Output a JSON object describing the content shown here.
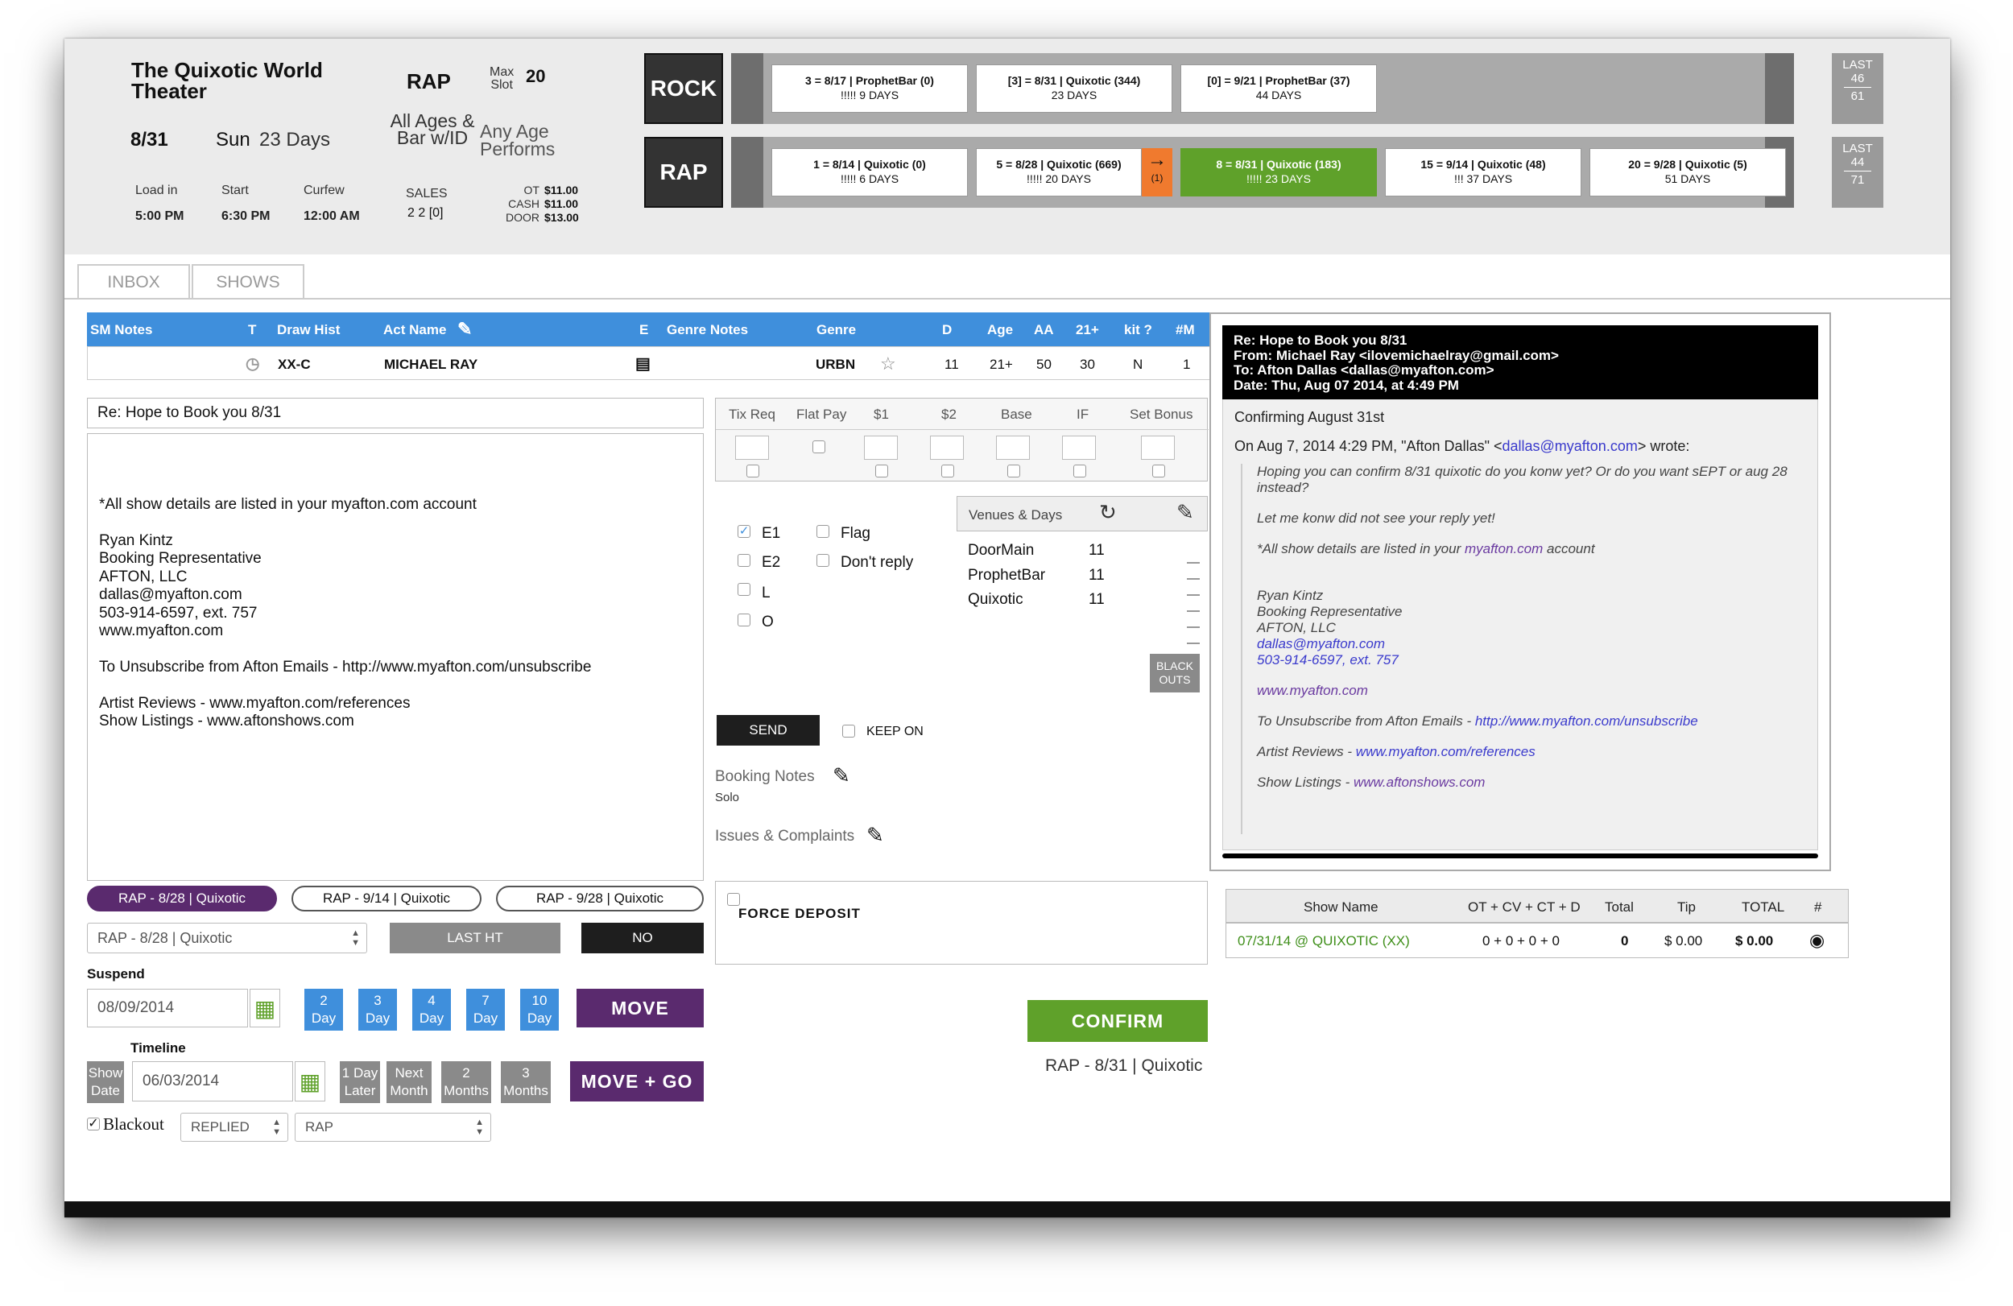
{
  "header": {
    "venue_name": "The Quixotic World Theater",
    "genre": "RAP",
    "max_slot_label1": "Max",
    "max_slot_label2": "Slot",
    "max_slot_value": "20",
    "date": "8/31",
    "day": "Sun",
    "days_away": "23 Days",
    "ages": "All Ages & Bar w/ID",
    "age_perf": "Any Age Performs",
    "load_in_label": "Load in",
    "load_in": "5:00 PM",
    "start_label": "Start",
    "start": "6:30 PM",
    "curfew_label": "Curfew",
    "curfew": "12:00 AM",
    "sales_label": "SALES",
    "sales": "2  2 [0]",
    "ot_label": "OT",
    "ot": "$11.00",
    "cash_label": "CASH",
    "cash": "$11.00",
    "door_label": "DOOR",
    "door": "$13.00"
  },
  "tracks": {
    "rock": {
      "label": "ROCK",
      "cards": [
        {
          "line1": "3  =  8/17  |  ProphetBar (0)",
          "line2": "!!!!!   9 DAYS"
        },
        {
          "line1": "[3]  =  8/31  |  Quixotic (344)",
          "line2": "23 DAYS"
        },
        {
          "line1": "[0]  =  9/21  |  ProphetBar (37)",
          "line2": "44 DAYS"
        }
      ],
      "last_label": "LAST",
      "last_a": "46",
      "last_b": "61"
    },
    "rap": {
      "label": "RAP",
      "cards": [
        {
          "line1": "1  =  8/14  |  Quixotic (0)",
          "line2": "!!!!!   6 DAYS"
        },
        {
          "line1": "5  =  8/28  |  Quixotic (669)",
          "line2": "!!!!!   20 DAYS"
        },
        {
          "line1": "8  =  8/31  |  Quixotic (183)",
          "line2": "!!!!!   23 DAYS"
        },
        {
          "line1": "15  =  9/14  |  Quixotic (48)",
          "line2": "!!!   37 DAYS"
        },
        {
          "line1": "20  =  9/28  |  Quixotic (5)",
          "line2": "51 DAYS"
        }
      ],
      "arrow_count": "(1)",
      "last_label": "LAST",
      "last_a": "44",
      "last_b": "71"
    }
  },
  "tabs": [
    "INBOX",
    "SHOWS"
  ],
  "grid": {
    "headers": [
      "SM Notes",
      "T",
      "Draw Hist",
      "Act Name",
      "E",
      "Genre Notes",
      "Genre",
      "D",
      "Age",
      "AA",
      "21+",
      "kit ?",
      "#M"
    ],
    "row": {
      "draw_hist": "XX-C",
      "act_name": "MICHAEL RAY",
      "genre": "URBN",
      "d": "11",
      "age": "21+",
      "aa": "50",
      "plus21": "30",
      "kit": "N",
      "m": "1"
    }
  },
  "compose": {
    "subject": "Re: Hope to Book you 8/31",
    "body": "\n\n\n*All show details are listed in your myafton.com account\n\nRyan Kintz\nBooking Representative\nAFTON, LLC\ndallas@myafton.com\n503-914-6597, ext. 757\nwww.myafton.com\n\nTo Unsubscribe from Afton Emails - http://www.myafton.com/unsubscribe\n\nArtist Reviews - www.myafton.com/references\nShow Listings - www.aftonshows.com"
  },
  "pills": [
    "RAP - 8/28 | Quixotic",
    "RAP - 9/14 | Quixotic",
    "RAP - 9/28 | Quixotic"
  ],
  "show_select": "RAP - 8/28 | Quixotic",
  "last_ht": "LAST HT",
  "no_label": "NO",
  "suspend": {
    "label": "Suspend",
    "date": "08/09/2014",
    "days": [
      {
        "n": "2",
        "u": "Day"
      },
      {
        "n": "3",
        "u": "Day"
      },
      {
        "n": "4",
        "u": "Day"
      },
      {
        "n": "7",
        "u": "Day"
      },
      {
        "n": "10",
        "u": "Day"
      }
    ],
    "move": "MOVE"
  },
  "timeline": {
    "label": "Timeline",
    "show_date_1": "Show",
    "show_date_2": "Date",
    "date": "06/03/2014",
    "b1a": "1 Day",
    "b1b": "Later",
    "b2a": "Next",
    "b2b": "Month",
    "b3a": "2",
    "b3b": "Months",
    "b4a": "3",
    "b4b": "Months",
    "move_go": "MOVE + GO"
  },
  "blackout": {
    "label": "Blackout",
    "status": "REPLIED",
    "genre": "RAP"
  },
  "pay": {
    "headers": [
      "Tix Req",
      "Flat Pay",
      "$1",
      "$2",
      "Base",
      "IF",
      "Set Bonus"
    ]
  },
  "flags": {
    "e1": "E1",
    "e2": "E2",
    "l": "L",
    "o": "O",
    "flag": "Flag",
    "dont_reply": "Don't reply"
  },
  "venues": {
    "title": "Venues & Days",
    "rows": [
      {
        "name": "DoorMain",
        "days": "11"
      },
      {
        "name": "ProphetBar",
        "days": "11"
      },
      {
        "name": "Quixotic",
        "days": "11"
      }
    ],
    "blackouts_1": "BLACK",
    "blackouts_2": "OUTS"
  },
  "send": "SEND",
  "keep_on": "KEEP ON",
  "booking_notes": {
    "label": "Booking Notes",
    "value": "Solo"
  },
  "issues": "Issues & Complaints",
  "force_deposit": "FORCE DEPOSIT",
  "confirm": "CONFIRM",
  "confirm_sub": "RAP - 8/31 | Quixotic",
  "email": {
    "subject": "Re: Hope to Book you 8/31",
    "from": "From: Michael Ray <ilovemichaelray@gmail.com>",
    "to": "To: Afton Dallas <dallas@myafton.com>",
    "date": "Date: Thu, Aug 07 2014, at 4:49 PM",
    "line1": "Confirming August 31st",
    "wrote_pre": "On Aug 7, 2014 4:29 PM, \"Afton Dallas\" <",
    "wrote_link": "dallas@myafton.com",
    "wrote_post": "> wrote:",
    "q1": "Hoping you can confirm 8/31 quixotic do you konw yet? Or do you want sEPT or aug 28 instead?",
    "q2": "Let me konw did not see your reply yet!",
    "q3_pre": "*All show details are listed in your ",
    "q3_link": "myafton.com",
    "q3_post": " account",
    "sig1": "Ryan Kintz",
    "sig2": "Booking Representative",
    "sig3": "AFTON, LLC",
    "sig4": "dallas@myafton.com",
    "sig5": "503-914-6597, ext. 757",
    "web": "www.myafton.com",
    "unsub_pre": "To Unsubscribe from Afton Emails - ",
    "unsub_link": "http://www.myafton.com/unsubscribe",
    "rev_pre": "Artist Reviews - ",
    "rev_link": "www.myafton.com/references",
    "list_pre": "Show Listings - ",
    "list_link": "www.aftonshows.com"
  },
  "shows_table": {
    "headers": [
      "Show Name",
      "OT + CV + CT + D",
      "Total",
      "Tip",
      "TOTAL",
      "#"
    ],
    "row": {
      "name": "07/31/14 @ QUIXOTIC  (XX)",
      "sum": "0 + 0 + 0 + 0",
      "total": "0",
      "tip": "$ 0.00",
      "grand": "$ 0.00"
    }
  },
  "colors": {
    "blue": "#3f8fdc",
    "purple": "#5a2a6e",
    "green": "#5fa12a",
    "orange": "#f07a2e"
  }
}
